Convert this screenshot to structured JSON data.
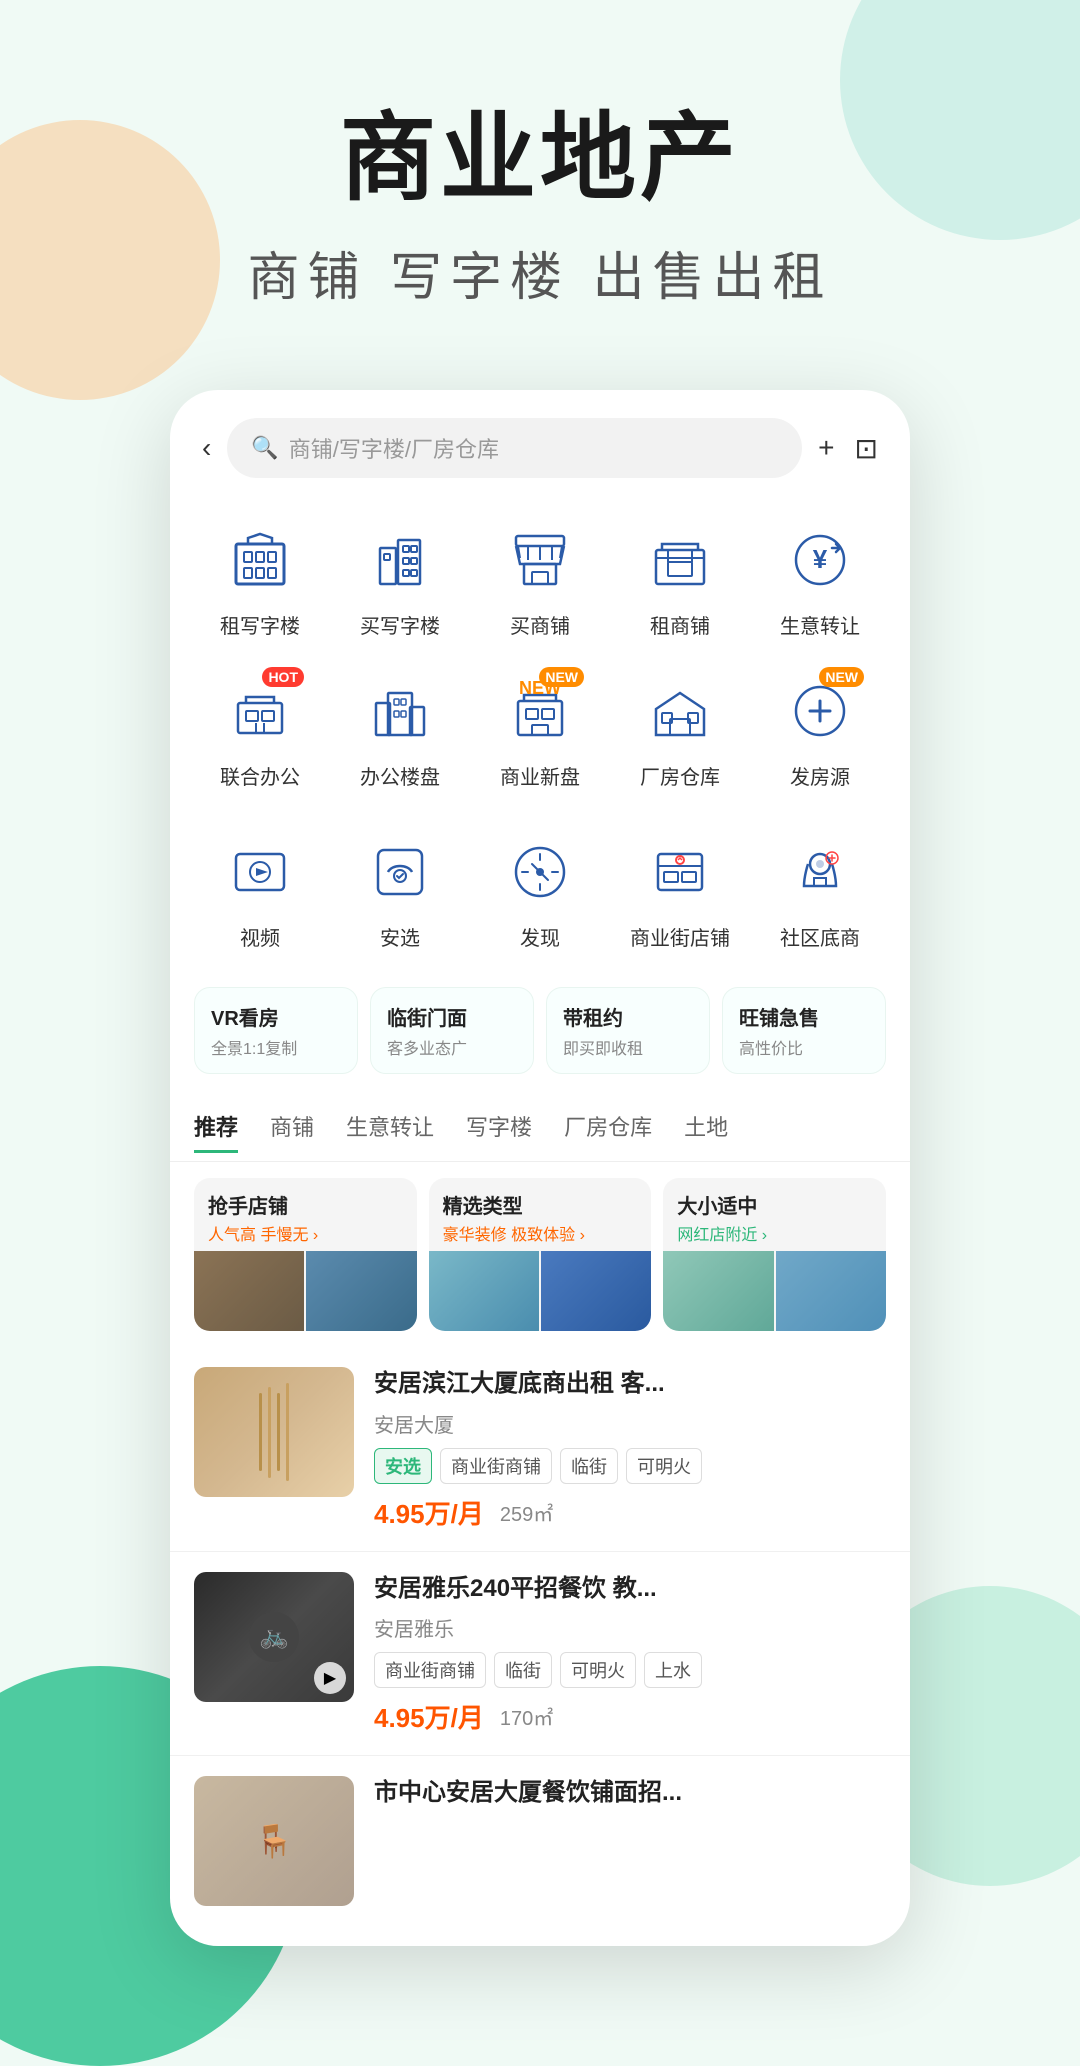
{
  "page": {
    "main_title": "商业地产",
    "sub_title": "商铺  写字楼  出售出租"
  },
  "topbar": {
    "back_label": "‹",
    "search_placeholder": "商铺/写字楼/厂房仓库",
    "plus_label": "+",
    "message_label": "⊡"
  },
  "categories": [
    {
      "id": "rent-office",
      "label": "租写字楼",
      "icon": "office-rent"
    },
    {
      "id": "buy-office",
      "label": "买写字楼",
      "icon": "office-buy"
    },
    {
      "id": "buy-shop",
      "label": "买商铺",
      "icon": "shop-buy"
    },
    {
      "id": "rent-shop",
      "label": "租商铺",
      "icon": "shop-rent"
    },
    {
      "id": "business-transfer",
      "label": "生意转让",
      "icon": "transfer"
    },
    {
      "id": "cowork",
      "label": "联合办公",
      "icon": "cowork",
      "badge": "HOT"
    },
    {
      "id": "office-estate",
      "label": "办公楼盘",
      "icon": "office-estate"
    },
    {
      "id": "commercial-new",
      "label": "商业新盘",
      "icon": "commercial-new",
      "badge": "NEW"
    },
    {
      "id": "warehouse",
      "label": "厂房仓库",
      "icon": "warehouse"
    },
    {
      "id": "post-source",
      "label": "发房源",
      "icon": "post",
      "badge": "NEW"
    }
  ],
  "secondary_categories": [
    {
      "id": "video",
      "label": "视频",
      "icon": "video"
    },
    {
      "id": "anx",
      "label": "安选",
      "icon": "anx"
    },
    {
      "id": "discover",
      "label": "发现",
      "icon": "compass"
    },
    {
      "id": "street-shop",
      "label": "商业街店铺",
      "icon": "street-shop"
    },
    {
      "id": "community",
      "label": "社区底商",
      "icon": "community"
    }
  ],
  "feature_cards": [
    {
      "title": "VR看房",
      "sub": "全景1:1复制"
    },
    {
      "title": "临街门面",
      "sub": "客多业态广"
    },
    {
      "title": "带租约",
      "sub": "即买即收租"
    },
    {
      "title": "旺铺急售",
      "sub": "高性价比"
    }
  ],
  "tabs": [
    {
      "label": "推荐",
      "active": true
    },
    {
      "label": "商铺",
      "active": false
    },
    {
      "label": "生意转让",
      "active": false
    },
    {
      "label": "写字楼",
      "active": false
    },
    {
      "label": "厂房仓库",
      "active": false
    },
    {
      "label": "土地",
      "active": false
    }
  ],
  "promo_cards": [
    {
      "title": "抢手店铺",
      "sub": "人气高 手慢无 ›",
      "sub_color": "orange"
    },
    {
      "title": "精选类型",
      "sub": "豪华装修 极致体验 ›",
      "sub_color": "orange"
    },
    {
      "title": "大小适中",
      "sub": "网红店附近 ›",
      "sub_color": "green"
    }
  ],
  "listings": [
    {
      "id": 1,
      "title": "安居滨江大厦底商出租 客...",
      "company": "安居大厦",
      "tags": [
        "安选",
        "商业街商铺",
        "临街",
        "可明火"
      ],
      "price": "4.95万/月",
      "area": "259㎡",
      "thumb": "shop1",
      "has_play": false
    },
    {
      "id": 2,
      "title": "安居雅乐240平招餐饮 教...",
      "company": "安居雅乐",
      "tags": [
        "商业街商铺",
        "临街",
        "可明火",
        "上水"
      ],
      "price": "4.95万/月",
      "area": "170㎡",
      "thumb": "shop2",
      "has_play": true
    },
    {
      "id": 3,
      "title": "市中心安居大厦餐饮铺面招...",
      "company": "",
      "tags": [],
      "price": "",
      "area": "",
      "thumb": "shop3",
      "has_play": false,
      "partial": true
    }
  ],
  "icons": {
    "search": "🔍",
    "back": "‹",
    "plus": "+",
    "play": "▶"
  }
}
